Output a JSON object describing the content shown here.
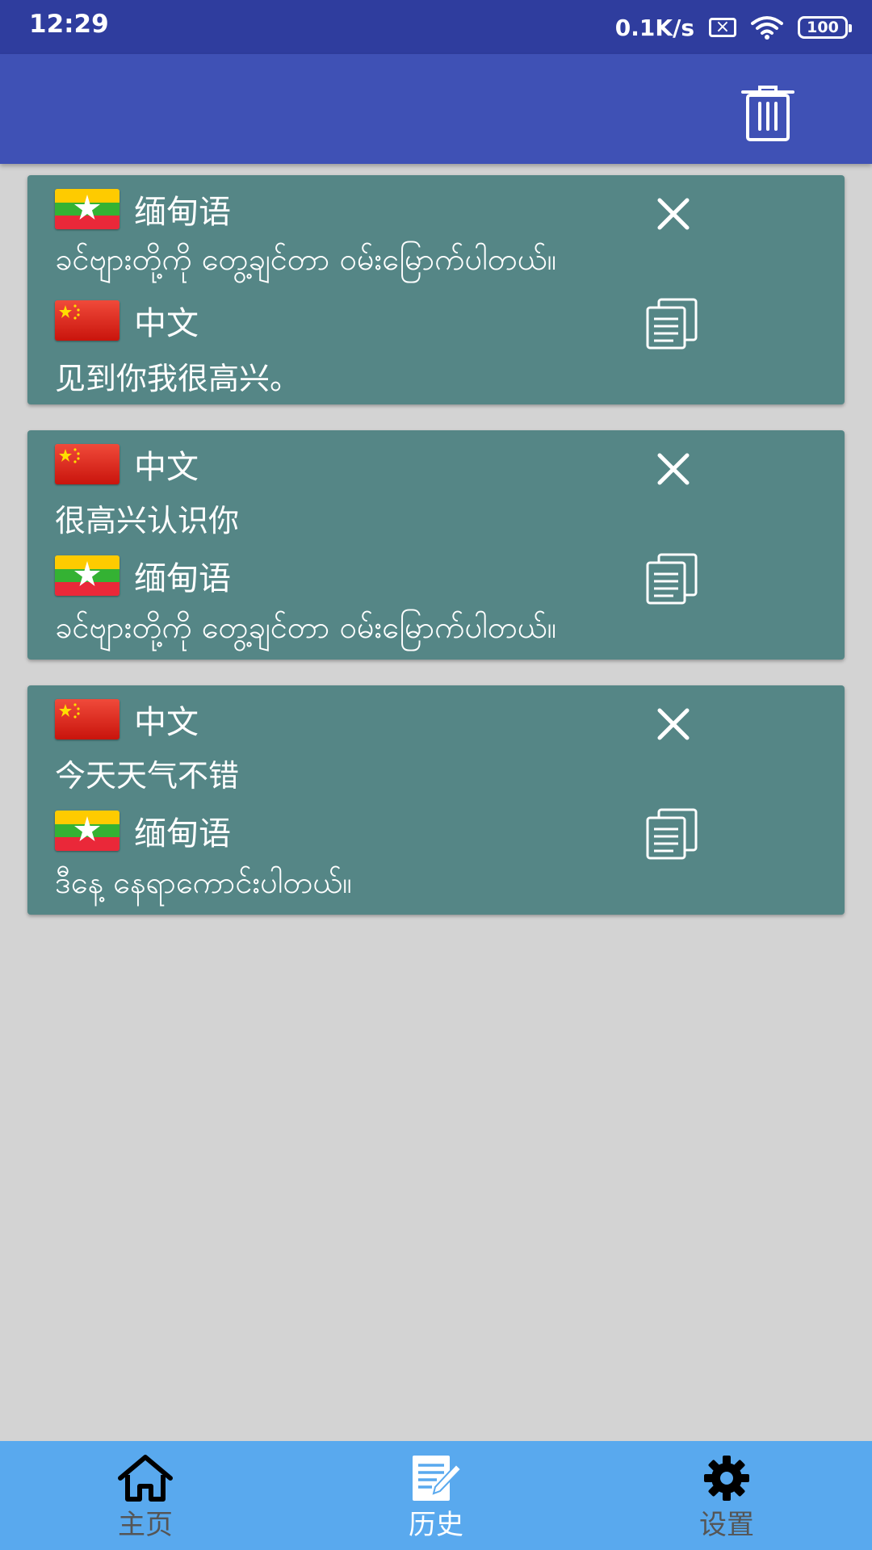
{
  "status": {
    "time": "12:29",
    "speed": "0.1K/s",
    "battery": "100"
  },
  "history": [
    {
      "source_lang": "缅甸语",
      "source_flag": "myanmar",
      "source_text": "ခင်ဗျားတို့ကို တွေ့ချင်တာ ဝမ်းမြောက်ပါတယ်။",
      "target_lang": "中文",
      "target_flag": "china",
      "target_text": "见到你我很高兴。"
    },
    {
      "source_lang": "中文",
      "source_flag": "china",
      "source_text": "很高兴认识你",
      "target_lang": "缅甸语",
      "target_flag": "myanmar",
      "target_text": "ခင်ဗျားတို့ကို တွေ့ချင်တာ ဝမ်းမြောက်ပါတယ်။"
    },
    {
      "source_lang": "中文",
      "source_flag": "china",
      "source_text": "今天天气不错",
      "target_lang": "缅甸语",
      "target_flag": "myanmar",
      "target_text": "ဒီနေ့ နေရာကောင်းပါတယ်။"
    }
  ],
  "nav": [
    {
      "label": "主页",
      "icon": "home-icon",
      "active": false
    },
    {
      "label": "历史",
      "icon": "history-icon",
      "active": true
    },
    {
      "label": "设置",
      "icon": "gear-icon",
      "active": false
    }
  ],
  "colors": {
    "statusbar": "#2f3d9e",
    "appbar": "#3f51b5",
    "card": "#558686",
    "nav": "#59a9ee",
    "background": "#d3d3d3"
  }
}
